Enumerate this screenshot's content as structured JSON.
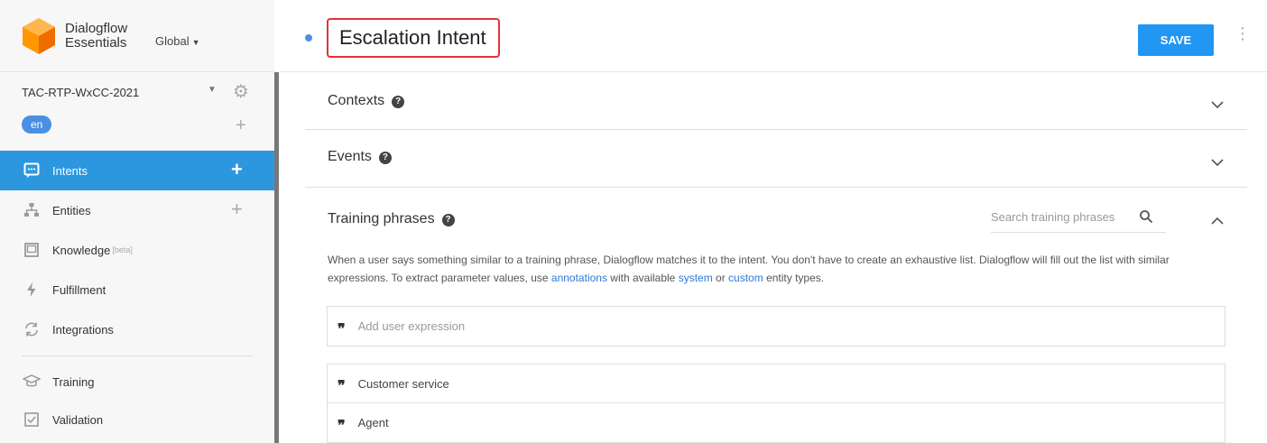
{
  "brand": {
    "line1": "Dialogflow",
    "line2": "Essentials",
    "region": "Global"
  },
  "agent": {
    "name": "TAC-RTP-WxCC-2021",
    "language": "en"
  },
  "nav": {
    "intents": "Intents",
    "entities": "Entities",
    "knowledge": "Knowledge",
    "knowledge_badge": "[beta]",
    "fulfillment": "Fulfillment",
    "integrations": "Integrations",
    "training": "Training",
    "validation": "Validation"
  },
  "header": {
    "title": "Escalation Intent",
    "save_label": "SAVE"
  },
  "sections": {
    "contexts": "Contexts",
    "events": "Events",
    "training": "Training phrases",
    "help_glyph": "?"
  },
  "search": {
    "placeholder": "Search training phrases"
  },
  "description": {
    "part1": "When a user says something similar to a training phrase, Dialogflow matches it to the intent. You don't have to create an exhaustive list. Dialogflow will fill out the list with similar expressions. To extract parameter values, use ",
    "link_annotations": "annotations",
    "part2": " with available ",
    "link_system": "system",
    "part3": " or ",
    "link_custom": "custom",
    "part4": " entity types."
  },
  "add_expression": {
    "placeholder": "Add user expression"
  },
  "phrases": [
    "Customer service",
    "Agent"
  ],
  "colors": {
    "accent": "#2c97de",
    "save": "#2196f3",
    "highlight": "#e2333d",
    "link": "#2c7ad6"
  }
}
